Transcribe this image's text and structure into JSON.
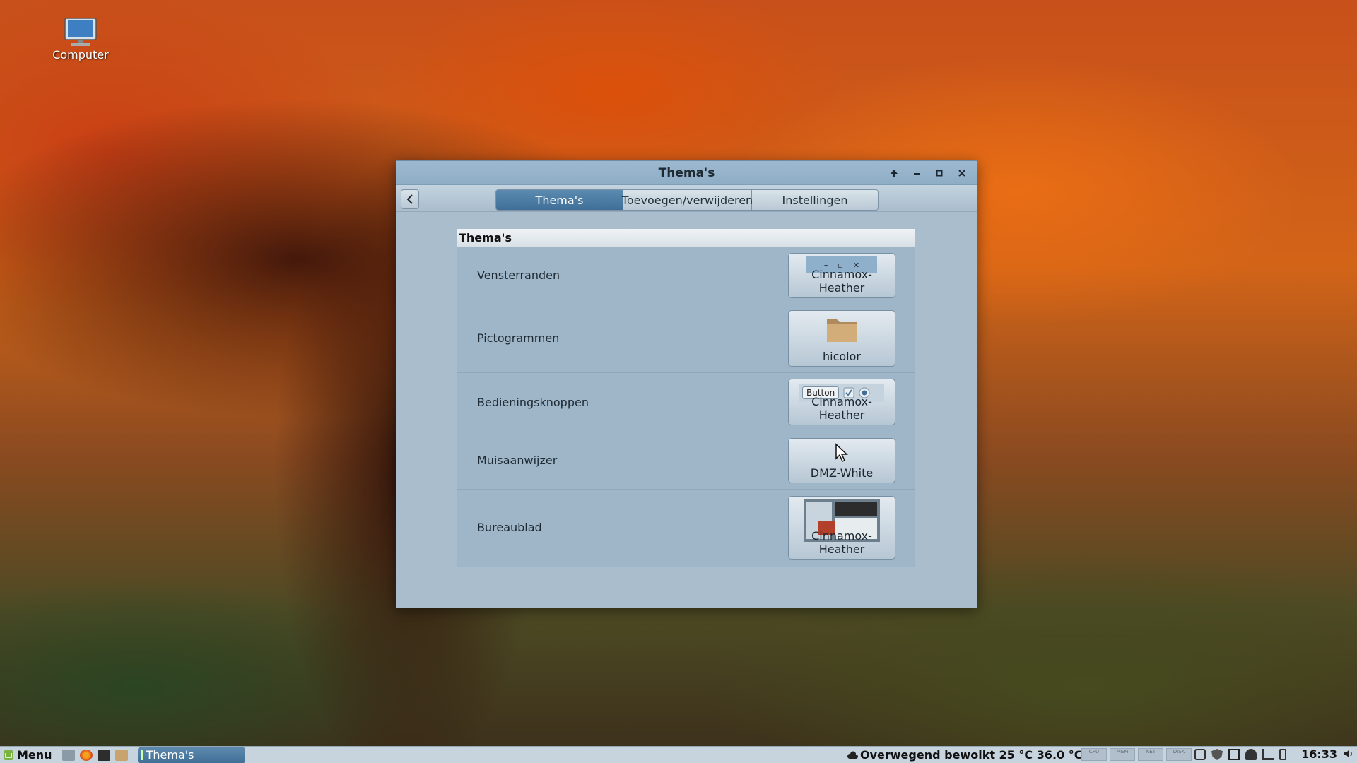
{
  "desktop": {
    "icons": [
      {
        "label": "Computer",
        "icon": "computer-icon"
      }
    ]
  },
  "window": {
    "title": "Thema's",
    "controls": [
      "keep-above",
      "minimize",
      "maximize",
      "close"
    ],
    "tabs": [
      {
        "label": "Thema's",
        "active": true
      },
      {
        "label": "Toevoegen/verwijderen",
        "active": false
      },
      {
        "label": "Instellingen",
        "active": false
      }
    ],
    "panel": {
      "header": "Thema's",
      "rows": [
        {
          "label": "Vensterranden",
          "value": "Cinnamox-Heather",
          "preview": "window-controls-preview"
        },
        {
          "label": "Pictogrammen",
          "value": "hicolor",
          "preview": "folder-icon"
        },
        {
          "label": "Bedieningsknoppen",
          "value": "Cinnamox-Heather",
          "preview": "controls-preview",
          "preview_button_text": "Button"
        },
        {
          "label": "Muisaanwijzer",
          "value": "DMZ-White",
          "preview": "cursor-icon"
        },
        {
          "label": "Bureaublad",
          "value": "Cinnamox-Heather",
          "preview": "desktop-thumbnail"
        }
      ]
    }
  },
  "taskbar": {
    "menu_label": "Menu",
    "task_label": "Thema's",
    "weather": "Overwegend bewolkt 25 °C 36.0 °C",
    "monitors": [
      "CPU",
      "MEM",
      "NET",
      "DISK"
    ],
    "clock": "16:33"
  },
  "colors": {
    "accent": "#4a7aa3",
    "window_bg": "#a9bdcc",
    "titlebar": "#94b2ca"
  }
}
